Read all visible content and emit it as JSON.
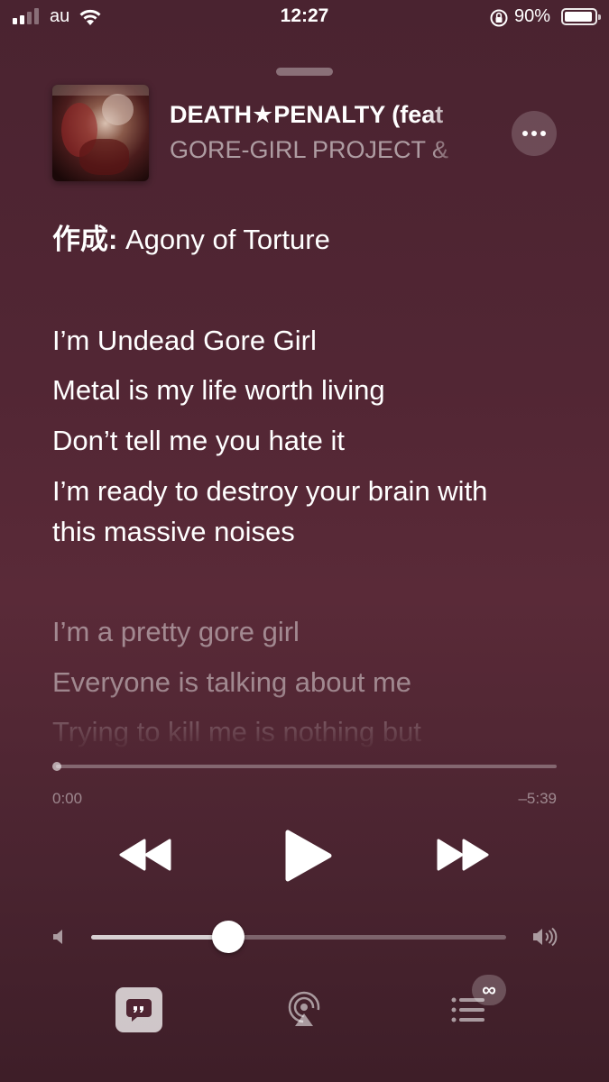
{
  "status_bar": {
    "carrier": "au",
    "time": "12:27",
    "battery_percent": "90%",
    "signal_bars": 2,
    "battery_level": 0.9
  },
  "now_playing": {
    "title": "DEATH★PENALTY (feat",
    "artist": "GORE-GIRL PROJECT &",
    "more_icon": "ellipsis-icon"
  },
  "lyrics": {
    "credit_label": "作成:",
    "credit_name": " Agony of Torture",
    "lines_active": [
      "I’m Undead Gore Girl",
      "Metal is my life worth living",
      "Don’t tell me you hate it",
      "I’m ready to destroy your brain with",
      "this massive noises"
    ],
    "lines_upcoming": [
      "I’m a pretty gore girl",
      "Everyone is talking about me",
      "Trying to kill me is nothing but"
    ]
  },
  "playback": {
    "elapsed": "0:00",
    "remaining": "–5:39",
    "progress_fraction": 0.0
  },
  "volume": {
    "level_fraction": 0.33
  },
  "bottom_bar": {
    "lyrics_icon": "lyrics-quote-icon",
    "airplay_icon": "airplay-audio-icon",
    "queue_icon": "up-next-list-icon",
    "autoplay_badge": "∞"
  },
  "colors": {
    "background": "#4f2532",
    "text_primary": "#ffffff",
    "text_secondary": "rgba(255,255,255,0.45)"
  }
}
